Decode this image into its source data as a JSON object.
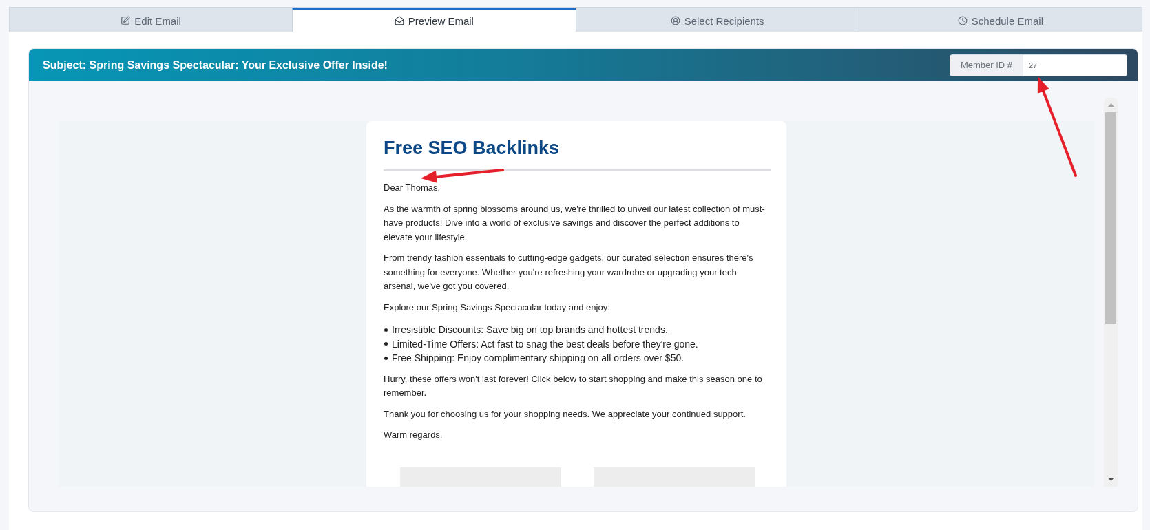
{
  "tabs": [
    {
      "label": "Edit Email",
      "selected": false
    },
    {
      "label": "Preview Email",
      "selected": true
    },
    {
      "label": "Select Recipients",
      "selected": false
    },
    {
      "label": "Schedule Email",
      "selected": false
    }
  ],
  "subject_bar": {
    "subject": "Subject: Spring Savings Spectacular: Your Exclusive Offer Inside!",
    "member_id": {
      "label": "Member ID #",
      "value": "27"
    }
  },
  "email": {
    "title": "Free SEO Backlinks",
    "body": [
      {
        "kind": "paragraph",
        "text": "Dear Thomas,"
      },
      {
        "kind": "paragraph",
        "text": "As the warmth of spring blossoms around us, we're thrilled to unveil our latest collection of must-have products! Dive into a world of exclusive savings and discover the perfect additions to elevate your lifestyle."
      },
      {
        "kind": "paragraph",
        "text": "From trendy fashion essentials to cutting-edge gadgets, our curated selection ensures there's something for everyone. Whether you're refreshing your wardrobe or upgrading your tech arsenal, we've got you covered."
      },
      {
        "kind": "paragraph",
        "text": "Explore our Spring Savings Spectacular today and enjoy:"
      },
      {
        "kind": "list",
        "items": [
          "Irresistible Discounts: Save big on top brands and hottest trends.",
          "Limited-Time Offers: Act fast to snag the best deals before they're gone.",
          "Free Shipping: Enjoy complimentary shipping on all orders over $50."
        ]
      },
      {
        "kind": "paragraph",
        "text": "Hurry, these offers won't last forever! Click below to start shopping and make this season one to remember."
      },
      {
        "kind": "paragraph",
        "text": "Thank you for choosing us for your shopping needs. We appreciate your continued support."
      },
      {
        "kind": "paragraph",
        "text": "Warm regards,"
      }
    ],
    "images": [
      {
        "kind": "image"
      },
      {
        "kind": "image"
      }
    ]
  },
  "annotations": [
    {
      "kind": "arrow"
    },
    {
      "kind": "arrow"
    }
  ]
}
